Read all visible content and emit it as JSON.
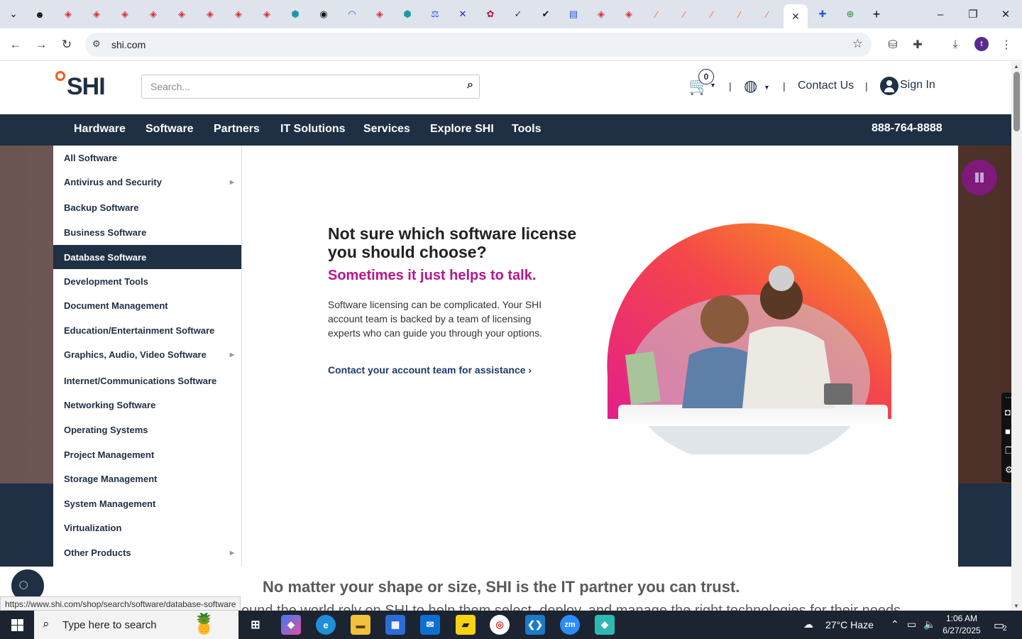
{
  "browser": {
    "active_tab_close": "✕",
    "new_tab": "+",
    "address": "shi.com",
    "profile_initial": "t"
  },
  "header": {
    "logo_text": "SHI",
    "search_placeholder": "Search...",
    "cart_count": "0",
    "separator": "|",
    "contact": "Contact Us",
    "signin": "Sign In"
  },
  "nav": {
    "items": [
      "Hardware",
      "Software",
      "Partners",
      "IT Solutions",
      "Services",
      "Explore SHI",
      "Tools"
    ],
    "phone": "888-764-8888"
  },
  "menu": {
    "items": [
      {
        "label": "All Software",
        "arrow": false
      },
      {
        "label": "Antivirus and Security",
        "arrow": true
      },
      {
        "label": "Backup Software",
        "arrow": false
      },
      {
        "label": "Business Software",
        "arrow": false
      },
      {
        "label": "Database Software",
        "arrow": false,
        "active": true
      },
      {
        "label": "Development Tools",
        "arrow": false
      },
      {
        "label": "Document Management",
        "arrow": false
      },
      {
        "label": "Education/Entertainment Software",
        "arrow": false
      },
      {
        "label": "Graphics, Audio, Video Software",
        "arrow": true
      },
      {
        "label": "Internet/Communications Software",
        "arrow": false
      },
      {
        "label": "Networking Software",
        "arrow": false
      },
      {
        "label": "Operating Systems",
        "arrow": false
      },
      {
        "label": "Project Management",
        "arrow": false
      },
      {
        "label": "Storage Management",
        "arrow": false
      },
      {
        "label": "System Management",
        "arrow": false
      },
      {
        "label": "Virtualization",
        "arrow": false
      },
      {
        "label": "Other Products",
        "arrow": true
      }
    ]
  },
  "promo": {
    "title": "Not sure which software license you should choose?",
    "subtitle": "Sometimes it just helps to talk.",
    "body": "Software licensing can be complicated. Your SHI account team is backed by a team of licensing experts who can guide you through your options.",
    "link": "Contact your account team for assistance"
  },
  "page": {
    "tagline": "No matter your shape or size, SHI is the IT partner you can trust.",
    "tagline2": "ound the world rely on SHI to help them select, deploy, and manage the right technologies for their needs",
    "status_url": "https://www.shi.com/shop/search/software/database-software"
  },
  "taskbar": {
    "search_placeholder": "Type here to search",
    "weather": "27°C  Haze",
    "time": "1:06 AM",
    "date": "6/27/2025",
    "notif_count": "2"
  },
  "colors": {
    "navy": "#1f2f44",
    "magenta": "#b5178f",
    "shi_orange": "#f25c22"
  }
}
